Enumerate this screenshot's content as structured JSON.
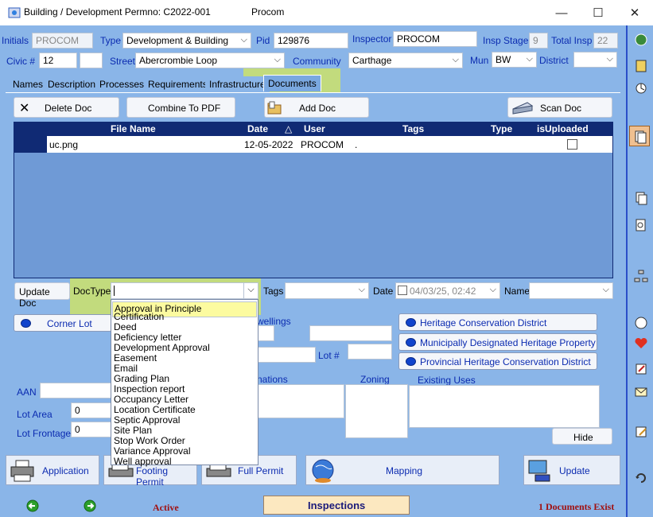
{
  "window": {
    "title": "Building / Development Permno: C2022-001",
    "app_name": "Procom",
    "minimize": "—",
    "maximize": "☐",
    "close": "✕"
  },
  "header": {
    "initials_label": "Initials",
    "initials_value": "PROCOM",
    "type_label": "Type",
    "type_value": "Development & Building",
    "pid_label": "Pid",
    "pid_value": "129876",
    "inspector_label": "Inspector",
    "inspector_value": "PROCOM",
    "insp_stage_label": "Insp Stage",
    "insp_stage_value": "9",
    "total_insp_label": "Total Insp",
    "total_insp_value": "22",
    "civic_label": "Civic #",
    "civic_value": "12",
    "civic_suffix": "",
    "street_label": "Street",
    "street_value": "Abercrombie Loop",
    "community_label": "Community",
    "community_value": "Carthage",
    "mun_label": "Mun",
    "mun_value": "BW",
    "district_label": "District",
    "district_value": ""
  },
  "tabs": [
    "Names",
    "Description",
    "Processes",
    "Requirements",
    "Infrastructure",
    "Documents"
  ],
  "toolbar": {
    "delete_doc": "Delete Doc",
    "combine_pdf": "Combine To PDF",
    "add_doc": "Add Doc",
    "scan_doc": "Scan Doc"
  },
  "grid": {
    "columns": [
      "File Name",
      "Date",
      "User",
      "Tags",
      "Type",
      "isUploaded"
    ],
    "sort_indicator": "△",
    "rows": [
      {
        "file": "uc.png",
        "date": "12-05-2022",
        "user": "PROCOM",
        "tags": ".",
        "type": "",
        "uploaded": false
      }
    ]
  },
  "docedit": {
    "update_doc": "Update Doc",
    "doctype_label": "DocType",
    "doctype_value": "",
    "tags_label": "Tags",
    "date_label": "Date",
    "date_value": "04/03/25, 02:42",
    "name_label": "Name"
  },
  "doctype_options": [
    "Approval in Principle",
    "Certification",
    "Deed",
    "Deficiency letter",
    "Development Approval",
    "Easement",
    "Email",
    "Grading Plan",
    "Inspection report",
    "Occupancy Letter",
    "Location Certificate",
    "Septic Approval",
    "Site Plan",
    "Stop Work Order",
    "Variance Approval",
    "Well approval"
  ],
  "lower": {
    "corner_lot": "Corner Lot",
    "dwellings_partial": "wellings",
    "lot_label": "Lot #",
    "designations_partial": "nations",
    "zoning_label": "Zoning",
    "existing_uses_label": "Existing Uses",
    "aan_label": "AAN",
    "lot_area_label": "Lot Area",
    "lot_area_value": "0",
    "lot_frontage_label": "Lot Frontage",
    "lot_frontage_value": "0",
    "heritage_district": "Heritage Conservation District",
    "municipal_heritage": "Municipally Designated Heritage Property",
    "provincial_heritage": "Provincial Heritage Conservation District",
    "hide": "Hide"
  },
  "bottom_buttons": {
    "application": "Application",
    "footing_permit": "Footing Permit",
    "full_permit": "Full Permit",
    "mapping": "Mapping",
    "update": "Update"
  },
  "status": {
    "active": "Active",
    "inspections": "Inspections",
    "docs_exist": "1 Documents Exist"
  },
  "colors": {
    "panel": "#8ab5e8",
    "grid_header": "#102a74",
    "highlight": "#d4e85a",
    "label_blue": "#0b2bb0",
    "status_red": "#a01010"
  }
}
